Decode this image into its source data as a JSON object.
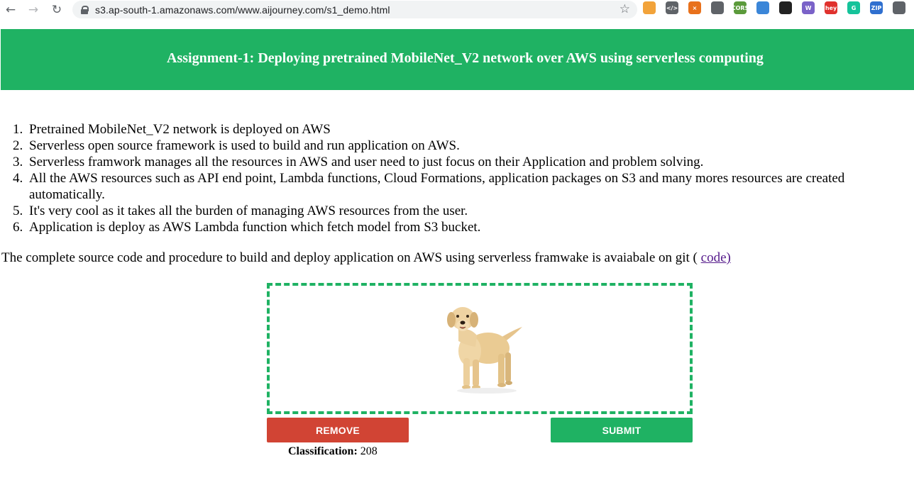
{
  "browser": {
    "url": "s3.ap-south-1.amazonaws.com/www.aijourney.com/s1_demo.html",
    "back_icon": "back-arrow-icon",
    "forward_icon": "forward-arrow-icon",
    "reload_icon": "reload-icon",
    "extensions": [
      {
        "name": "extension-pencil-icon",
        "color": "#f2a33a",
        "label": ""
      },
      {
        "name": "extension-code-icon",
        "color": "#5f6368",
        "label": "</>"
      },
      {
        "name": "extension-orange-x-icon",
        "color": "#e8711c",
        "label": "×"
      },
      {
        "name": "extension-gray-circle-icon",
        "color": "#5f6368",
        "label": ""
      },
      {
        "name": "extension-cors-icon",
        "color": "#5b9a3b",
        "label": "CORS"
      },
      {
        "name": "extension-cloud-icon",
        "color": "#3b86d8",
        "label": ""
      },
      {
        "name": "extension-box-icon",
        "color": "#222222",
        "label": ""
      },
      {
        "name": "extension-wp-icon",
        "color": "#7a62c8",
        "label": "W"
      },
      {
        "name": "extension-hey-icon",
        "color": "#e0312d",
        "label": "hey"
      },
      {
        "name": "extension-grammarly-icon",
        "color": "#15c39a",
        "label": "G"
      },
      {
        "name": "extension-zip-icon",
        "color": "#2f6fcf",
        "label": "ZIP"
      },
      {
        "name": "extension-puzzle-icon",
        "color": "#5f6368",
        "label": ""
      }
    ]
  },
  "header": {
    "title": "Assignment-1: Deploying pretrained MobileNet_V2 network over AWS using serverless computing"
  },
  "points": [
    {
      "num": "1.",
      "text": "Pretrained MobileNet_V2 network is deployed on AWS"
    },
    {
      "num": "2.",
      "text": "Serverless open source framework is used to build and run application on AWS."
    },
    {
      "num": "3.",
      "text": "Serverless framwork manages all the resources in AWS and user need to just focus on their Application and problem solving."
    },
    {
      "num": "4.",
      "text": "All the AWS resources such as API end point, Lambda functions, Cloud Formations, application packages on S3 and many mores resources are created automatically."
    },
    {
      "num": "5.",
      "text": "It's very cool as it takes all the burden of managing AWS resources from the user."
    },
    {
      "num": "6.",
      "text": "Application is deploy as AWS Lambda function which fetch model from S3 bucket."
    }
  ],
  "source": {
    "text": "The complete source code and procedure to build and deploy application on AWS using serverless framwake is avaiabale on git ( ",
    "link_text": "code)"
  },
  "upload": {
    "remove_label": "REMOVE",
    "submit_label": "SUBMIT"
  },
  "result": {
    "label": "Classification:",
    "value": "208"
  },
  "colors": {
    "accent_green": "#1fb263",
    "remove_red": "#d14434"
  }
}
